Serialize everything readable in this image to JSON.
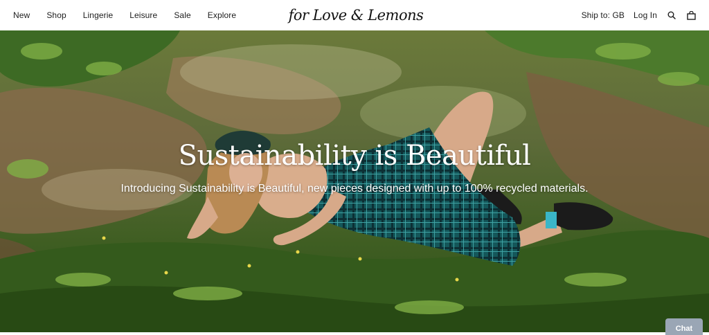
{
  "header": {
    "nav_left": [
      {
        "label": "New"
      },
      {
        "label": "Shop"
      },
      {
        "label": "Lingerie"
      },
      {
        "label": "Leisure"
      },
      {
        "label": "Sale"
      },
      {
        "label": "Explore"
      }
    ],
    "logo_text": "for Love & Lemons",
    "ship_to": "Ship to: GB",
    "login": "Log In",
    "icons": [
      "search-icon",
      "bag-icon"
    ]
  },
  "hero": {
    "title": "Sustainability is Beautiful",
    "subtitle": "Introducing Sustainability is Beautiful, new pieces designed with up to 100% recycled materials."
  },
  "chat": {
    "label": "Chat"
  },
  "colors": {
    "text_dark": "#1c1c1c",
    "grass_dark": "#2f4d1c",
    "grass_light": "#6f9a3a",
    "dirt": "#7a5a3e",
    "plaid": "#1b6b6e",
    "chat_bg": "#9aa6b5"
  }
}
